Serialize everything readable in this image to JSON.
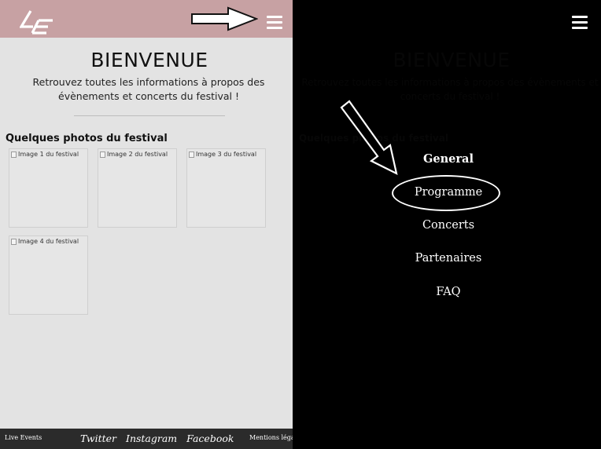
{
  "left": {
    "header": {
      "logo_text": "LE"
    },
    "title": "BIENVENUE",
    "subtitle": "Retrouvez toutes les informations à propos des évènements et concerts du festival !",
    "photos_title": "Quelques photos du festival",
    "photos": [
      {
        "alt": "Image 1 du festival"
      },
      {
        "alt": "Image 2 du festival"
      },
      {
        "alt": "Image 3 du festival"
      },
      {
        "alt": "Image 4 du festival"
      }
    ],
    "footer": {
      "brand": "Live Events",
      "social": [
        "Twitter",
        "Instagram",
        "Facebook"
      ],
      "legal": "Mentions légales"
    }
  },
  "right": {
    "menu": [
      "General",
      "Programme",
      "Concerts",
      "Partenaires",
      "FAQ"
    ]
  },
  "colors": {
    "header": "#c7a1a3",
    "page_bg": "#e3e3e3",
    "footer": "#2b2b2b",
    "overlay": "#000000"
  },
  "icons": [
    "logo-le",
    "hamburger-menu-icon",
    "arrow-annotation",
    "broken-image-icon"
  ]
}
